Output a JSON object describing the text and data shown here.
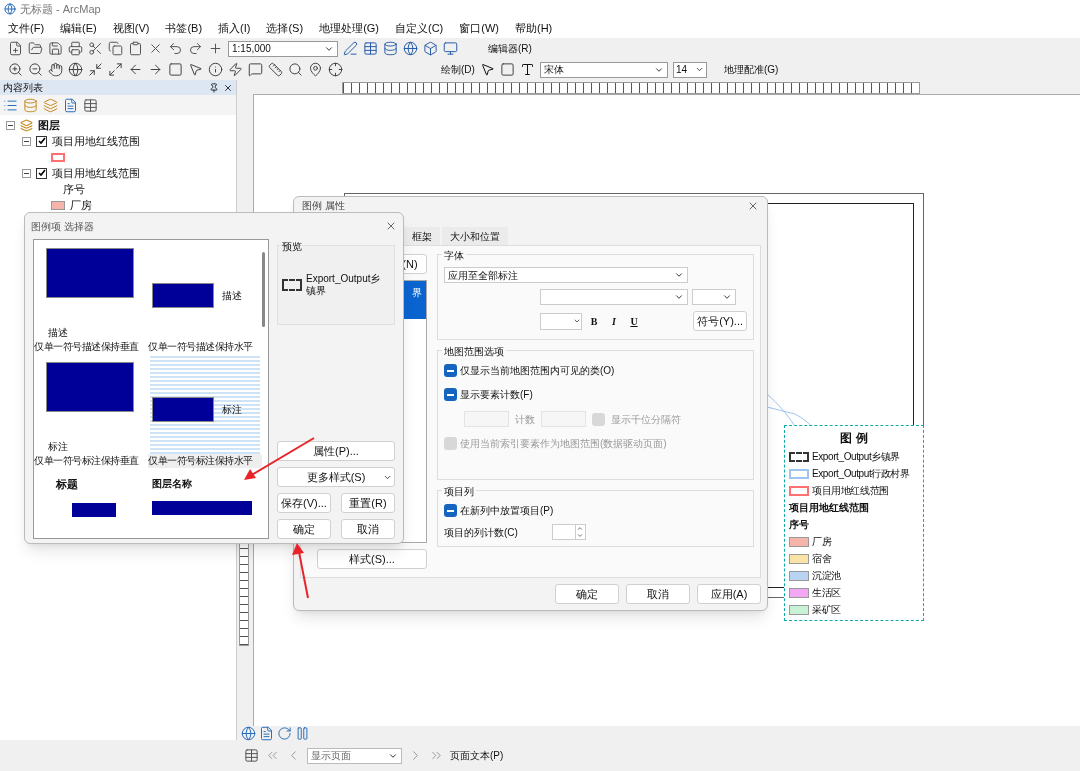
{
  "window": {
    "title": "无标题 - ArcMap"
  },
  "menu": [
    "文件(F)",
    "编辑(E)",
    "视图(V)",
    "书签(B)",
    "插入(I)",
    "选择(S)",
    "地理处理(G)",
    "自定义(C)",
    "窗口(W)",
    "帮助(H)"
  ],
  "toolbar": {
    "scale": "1:15,000",
    "editor": "编辑器(R)",
    "drawing": "绘制(D)",
    "font": "宋体",
    "font_size": "14",
    "georeferencing": "地理配准(G)"
  },
  "toc": {
    "title": "内容列表",
    "tree": [
      {
        "kind": "group",
        "label": "图层",
        "expanded": true,
        "children": [
          {
            "kind": "layer",
            "label": "项目用地红线范围",
            "checked": true,
            "expanded": true,
            "children": [
              {
                "kind": "outline_patch",
                "color": "#ff7070"
              }
            ]
          },
          {
            "kind": "layer",
            "label": "项目用地红线范围",
            "checked": true,
            "expanded": true,
            "children": [
              {
                "kind": "heading",
                "label": "序号"
              },
              {
                "kind": "fill_patch",
                "color": "#f4b4aa",
                "label": "厂房"
              }
            ]
          }
        ]
      }
    ]
  },
  "legend": {
    "title": "图 例",
    "items": [
      {
        "kind": "dashed_patch",
        "color": "#333333",
        "label": "Export_Output乡镇界"
      },
      {
        "kind": "outline_patch",
        "color": "#9ec4f0",
        "label": "Export_Output行政村界"
      },
      {
        "kind": "outline_patch",
        "color": "#ff7070",
        "label": "项目用地红线范围"
      },
      {
        "kind": "heading",
        "label": "项目用地红线范围"
      },
      {
        "kind": "subheading",
        "label": "序号"
      },
      {
        "kind": "fill_patch",
        "color": "#f4b4aa",
        "label": "厂房"
      },
      {
        "kind": "fill_patch",
        "color": "#fbe3a8",
        "label": "宿舍"
      },
      {
        "kind": "fill_patch",
        "color": "#b9d3f3",
        "label": "沉淀池"
      },
      {
        "kind": "fill_patch",
        "color": "#f2a8f2",
        "label": "生活区"
      },
      {
        "kind": "fill_patch",
        "color": "#c8f2d6",
        "label": "采矿区"
      }
    ]
  },
  "properties": {
    "title": "图例 属性",
    "tabs": [
      {
        "label": "框架",
        "selected": false
      },
      {
        "label": "大小和位置",
        "selected": false
      }
    ],
    "left": {
      "button_fragment": "(N)",
      "list_fragment": "界",
      "style_button": "样式(S)..."
    },
    "font_group": {
      "title": "字体",
      "apply_combo": "应用至全部标注",
      "format": [
        "B",
        "I",
        "U"
      ],
      "symbol_button": "符号(Y)..."
    },
    "extent_group": {
      "title": "地图范围选项",
      "rows": [
        {
          "kind": "check",
          "label": "仅显示当前地图范围内可见的类(O)",
          "checked": true,
          "disabled": false
        },
        {
          "kind": "check",
          "label": "显示要素计数(F)",
          "checked": true,
          "disabled": false
        },
        {
          "kind": "count",
          "label": "计数",
          "option": {
            "label": "显示千位分隔符",
            "checked": false,
            "disabled": true
          }
        },
        {
          "kind": "check",
          "label": "使用当前索引要素作为地图范围(数据驱动页面)",
          "checked": false,
          "disabled": true
        }
      ]
    },
    "column_group": {
      "title": "项目列",
      "option": {
        "label": "在新列中放置项目(P)",
        "checked": true,
        "disabled": false
      },
      "count_label": "项目的列计数(C)"
    },
    "buttons": [
      "确定",
      "取消",
      "应用(A)"
    ]
  },
  "selector": {
    "title": "图例项 选择器",
    "gallery": [
      {
        "kind": "vertical",
        "caption": "描述",
        "label": "仅单一符号描述保持垂直",
        "selected": false
      },
      {
        "kind": "horizontal",
        "caption": "描述",
        "label": "仅单一符号描述保持水平",
        "selected": false
      },
      {
        "kind": "vertical",
        "caption": "标注",
        "label": "仅单一符号标注保持垂直",
        "selected": false
      },
      {
        "kind": "horizontal",
        "caption": "标注",
        "label": "仅单一符号标注保持水平",
        "selected": true
      },
      {
        "kind": "title",
        "caption": "标题",
        "selected": false
      },
      {
        "kind": "layer",
        "caption": "图层名称",
        "selected": false
      }
    ],
    "preview": {
      "title": "预览",
      "label": "Export_Output乡镇界"
    },
    "buttons": {
      "properties": "属性(P)...",
      "more": "更多样式(S)",
      "save": "保存(V)...",
      "reset": "重置(R)",
      "ok": "确定",
      "cancel": "取消"
    }
  },
  "status_bar": {
    "page_combo": "显示页面",
    "page_text": "页面文本(P)"
  }
}
